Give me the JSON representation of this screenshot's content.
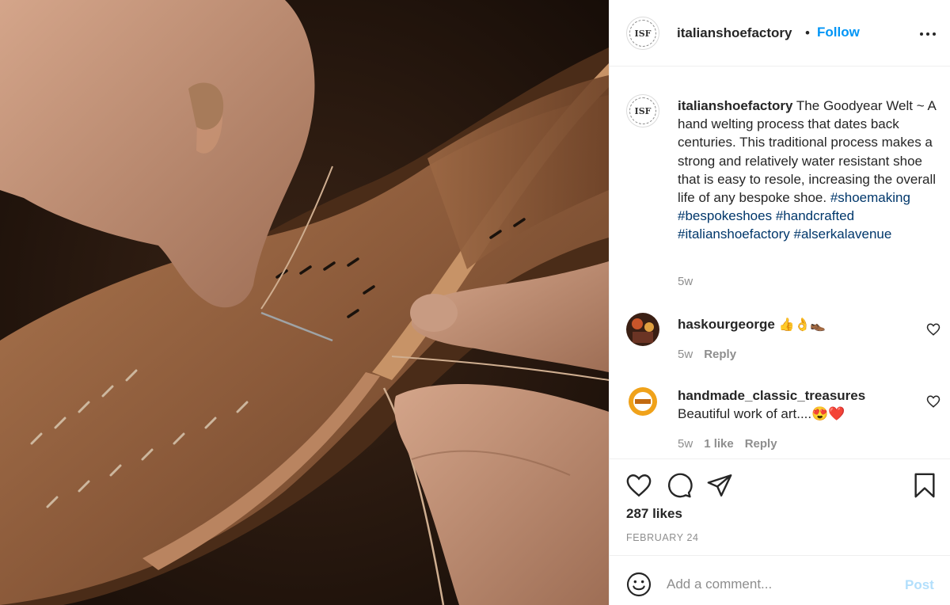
{
  "header": {
    "avatar_monogram": "ISF",
    "username": "italianshoefactory",
    "separator": "•",
    "follow_label": "Follow"
  },
  "caption": {
    "username": "italianshoefactory",
    "text": "The Goodyear Welt ~ A hand welting process that dates back centuries. This traditional process makes a strong and relatively water resistant shoe that is easy to resole, increasing the overall life of any bespoke shoe.",
    "hashtags": [
      "#shoemaking",
      "#bespokeshoes",
      "#handcrafted",
      "#italianshoefactory",
      "#alserkalavenue"
    ],
    "time": "5w"
  },
  "comments": [
    {
      "username": "haskourgeorge",
      "text": "👍👌👞",
      "time": "5w",
      "likes": "",
      "reply_label": "Reply"
    },
    {
      "username": "handmade_classic_treasures",
      "text": "Beautiful work of art....😍❤️",
      "time": "5w",
      "likes": "1 like",
      "reply_label": "Reply"
    }
  ],
  "actions": {
    "likes": "287 likes",
    "date": "FEBRUARY 24"
  },
  "add_comment": {
    "placeholder": "Add a comment...",
    "post_label": "Post"
  },
  "colors": {
    "accent": "#0095f6",
    "hashtag": "#00376b",
    "muted": "#8e8e8e",
    "post_disabled": "#b2dffc"
  },
  "icons": {
    "more": "more-options-icon",
    "like": "heart-icon",
    "comment": "comment-icon",
    "share": "paper-plane-icon",
    "save": "bookmark-icon",
    "emoji": "emoji-icon"
  }
}
